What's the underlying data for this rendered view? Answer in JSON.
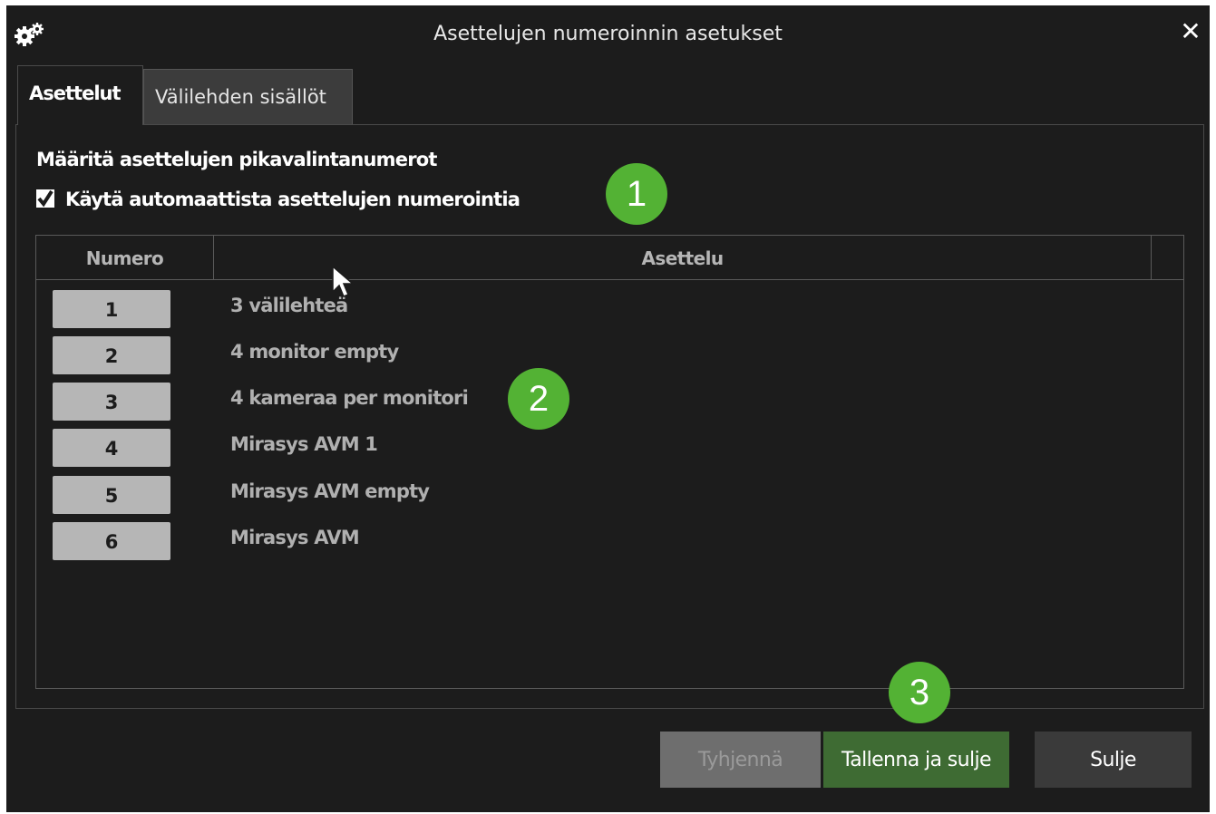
{
  "window": {
    "title": "Asettelujen numeroinnin asetukset",
    "close_glyph": "✕"
  },
  "tabs": [
    {
      "label": "Asettelut",
      "active": true
    },
    {
      "label": "Välilehden sisällöt",
      "active": false
    }
  ],
  "section": {
    "heading": "Määritä asettelujen pikavalintanumerot",
    "auto_numbering": {
      "label": "Käytä automaattista asettelujen numerointia",
      "checked": true
    }
  },
  "table": {
    "columns": [
      "Numero",
      "Asettelu"
    ],
    "rows": [
      {
        "number": "1",
        "layout": "3 välilehteä"
      },
      {
        "number": "2",
        "layout": "4 monitor empty"
      },
      {
        "number": "3",
        "layout": "4 kameraa per monitori"
      },
      {
        "number": "4",
        "layout": "Mirasys AVM 1"
      },
      {
        "number": "5",
        "layout": "Mirasys AVM empty"
      },
      {
        "number": "6",
        "layout": "Mirasys AVM"
      }
    ]
  },
  "callouts": [
    "1",
    "2",
    "3"
  ],
  "buttons": {
    "clear": "Tyhjennä",
    "save_close": "Tallenna ja sulje",
    "close": "Sulje"
  },
  "colors": {
    "callout": "#53b234",
    "save_button": "#3e6b33",
    "dialog_bg": "#1c1c1c"
  },
  "icons": {
    "settings": "gears-icon",
    "close": "close-icon",
    "checkbox": "check-icon",
    "pointer": "mouse-pointer-icon"
  }
}
